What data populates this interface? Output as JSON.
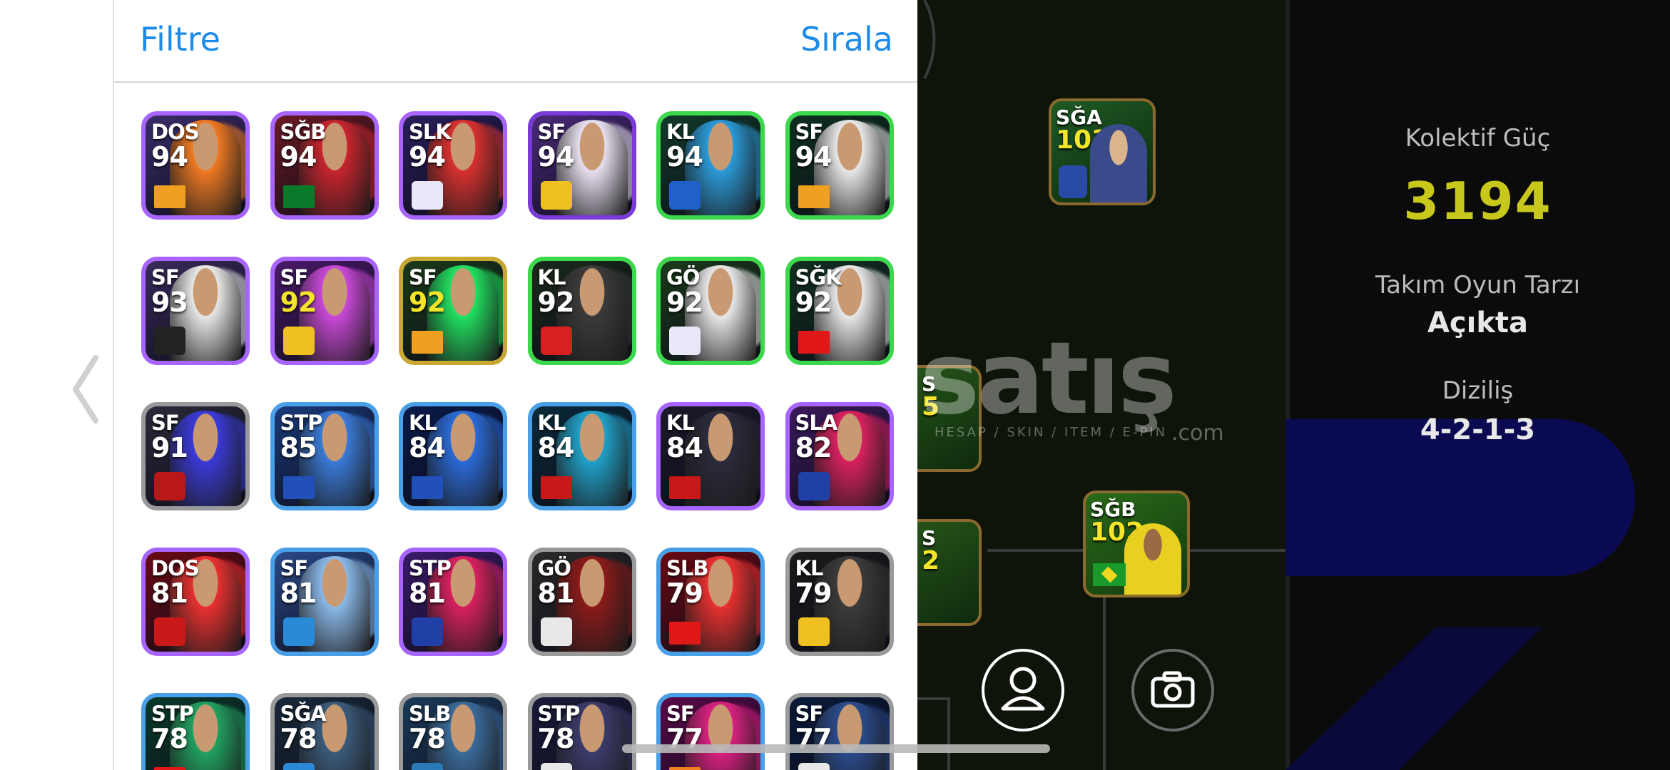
{
  "header": {
    "filter_label": "Filtre",
    "sort_label": "Sırala"
  },
  "cards": [
    {
      "pos": "DOS",
      "ovr": "94",
      "frame": "#a864ff",
      "bg": "#3b2d6a",
      "glow": "#f07a24",
      "badge": "flag-galatasaray",
      "badge_color": "#f0a020"
    },
    {
      "pos": "SĞB",
      "ovr": "94",
      "frame": "#a864ff",
      "bg": "#6a1a24",
      "glow": "#c8242e",
      "badge": "flag-portugal",
      "badge_color": "#0a7a2a"
    },
    {
      "pos": "SLK",
      "ovr": "94",
      "frame": "#a864ff",
      "bg": "#2a1e5c",
      "glow": "#d83030",
      "badge": "club-badge",
      "badge_color": "#e8e8f8"
    },
    {
      "pos": "SF",
      "ovr": "94",
      "frame": "#7a3ad8",
      "bg": "#4a2a7a",
      "glow": "#e8e0f0",
      "badge": "club-badge",
      "badge_color": "#f0c020"
    },
    {
      "pos": "KL",
      "ovr": "94",
      "frame": "#3ad84a",
      "bg": "#123a2a",
      "glow": "#2a9ad8",
      "badge": "club-badge",
      "badge_color": "#2060c8"
    },
    {
      "pos": "SF",
      "ovr": "94",
      "frame": "#3ad84a",
      "bg": "#0e3020",
      "glow": "#e8e8e8",
      "badge": "flag-galatasaray",
      "badge_color": "#f0a020"
    },
    {
      "pos": "SF",
      "ovr": "93",
      "frame": "#a864ff",
      "bg": "#3a2a5a",
      "glow": "#e8e8e8",
      "badge": "club-badge",
      "badge_color": "#222222"
    },
    {
      "pos": "SF",
      "ovr": "92",
      "frame": "#a864ff",
      "bg": "#4a1a6a",
      "glow": "#c848d8",
      "badge": "club-badge",
      "badge_color": "#f0c020",
      "gold": true
    },
    {
      "pos": "SF",
      "ovr": "92",
      "frame": "#c8a830",
      "bg": "#1a3a1a",
      "glow": "#20e060",
      "badge": "flag-galatasaray",
      "badge_color": "#f0a020",
      "gold": true
    },
    {
      "pos": "KL",
      "ovr": "92",
      "frame": "#3ad84a",
      "bg": "#1a2a1a",
      "glow": "#3a3a3a",
      "badge": "club-badge",
      "badge_color": "#d82020"
    },
    {
      "pos": "GÖ",
      "ovr": "92",
      "frame": "#3ad84a",
      "bg": "#1a3a1a",
      "glow": "#e8e8e8",
      "badge": "club-badge",
      "badge_color": "#e8e8f8"
    },
    {
      "pos": "SĞK",
      "ovr": "92",
      "frame": "#3ad84a",
      "bg": "#123020",
      "glow": "#e8e8e8",
      "badge": "flag-turkey",
      "badge_color": "#e01818"
    },
    {
      "pos": "SF",
      "ovr": "91",
      "frame": "#9a9a9a",
      "bg": "#2a2a3a",
      "glow": "#3a3ad8",
      "badge": "club-badge",
      "badge_color": "#b81818"
    },
    {
      "pos": "STP",
      "ovr": "85",
      "frame": "#4aa0e8",
      "bg": "#1a3a7a",
      "glow": "#3a7ad8",
      "badge": "flag-france",
      "badge_color": "#2050b8"
    },
    {
      "pos": "KL",
      "ovr": "84",
      "frame": "#4aa0e8",
      "bg": "#0a1a4a",
      "glow": "#2a6ad8",
      "badge": "flag-france",
      "badge_color": "#2050b8"
    },
    {
      "pos": "KL",
      "ovr": "84",
      "frame": "#4aa0e8",
      "bg": "#0a2a3a",
      "glow": "#20a0c8",
      "badge": "flag-morocco",
      "badge_color": "#c81818"
    },
    {
      "pos": "KL",
      "ovr": "84",
      "frame": "#a864ff",
      "bg": "#1a1a2a",
      "glow": "#2a2a3a",
      "badge": "flag-morocco",
      "badge_color": "#c81818"
    },
    {
      "pos": "SLA",
      "ovr": "82",
      "frame": "#a864ff",
      "bg": "#3a1a5a",
      "glow": "#d82060",
      "badge": "club-badge",
      "badge_color": "#2040a8"
    },
    {
      "pos": "DOS",
      "ovr": "81",
      "frame": "#a864ff",
      "bg": "#6a0a14",
      "glow": "#e83030",
      "badge": "club-badge",
      "badge_color": "#c81818"
    },
    {
      "pos": "SF",
      "ovr": "81",
      "frame": "#4aa0e8",
      "bg": "#2a4a8a",
      "glow": "#8ab8e8",
      "badge": "club-badge",
      "badge_color": "#2a8ad8"
    },
    {
      "pos": "STP",
      "ovr": "81",
      "frame": "#a864ff",
      "bg": "#3a1a6a",
      "glow": "#d82060",
      "badge": "club-badge",
      "badge_color": "#2040a8"
    },
    {
      "pos": "GÖ",
      "ovr": "81",
      "frame": "#9a9a9a",
      "bg": "#2a2a2a",
      "glow": "#8a1a1a",
      "badge": "club-badge",
      "badge_color": "#e8e8e8"
    },
    {
      "pos": "SLB",
      "ovr": "79",
      "frame": "#4aa0e8",
      "bg": "#6a0a14",
      "glow": "#e83030",
      "badge": "flag-austria",
      "badge_color": "#e01818"
    },
    {
      "pos": "KL",
      "ovr": "79",
      "frame": "#9a9a9a",
      "bg": "#1a1a1a",
      "glow": "#3a3a3a",
      "badge": "club-badge",
      "badge_color": "#f0c020"
    },
    {
      "pos": "STP",
      "ovr": "78",
      "frame": "#4aa0e8",
      "bg": "#0a3a2a",
      "glow": "#20a060",
      "badge": "flag",
      "badge_color": "#e01818"
    },
    {
      "pos": "SĞA",
      "ovr": "78",
      "frame": "#9a9a9a",
      "bg": "#1a2a3a",
      "glow": "#3a5a7a",
      "badge": "club-badge",
      "badge_color": "#2a8ad8"
    },
    {
      "pos": "SLB",
      "ovr": "78",
      "frame": "#9a9a9a",
      "bg": "#1a3a5a",
      "glow": "#3a6a9a",
      "badge": "club-badge",
      "badge_color": "#2a7ab8"
    },
    {
      "pos": "STP",
      "ovr": "78",
      "frame": "#9a9a9a",
      "bg": "#1a1a3a",
      "glow": "#3a3a6a",
      "badge": "club-badge",
      "badge_color": "#e8e8e8"
    },
    {
      "pos": "SF",
      "ovr": "77",
      "frame": "#4aa0e8",
      "bg": "#5a0a4a",
      "glow": "#d82080",
      "badge": "flag",
      "badge_color": "#f08020"
    },
    {
      "pos": "SF",
      "ovr": "77",
      "frame": "#9a9a9a",
      "bg": "#0a1a3a",
      "glow": "#2a4a8a",
      "badge": "club-badge",
      "badge_color": "#e8e8e8"
    }
  ],
  "field": {
    "watermark": "satış",
    "watermark_sub": "HESAP / SKIN / ITEM / E-PIN",
    "watermark_com": ".com",
    "players": [
      {
        "pos": "SĞA",
        "ovr": "103",
        "badge": "club-badge"
      },
      {
        "pos": "SĞB",
        "ovr": "102",
        "badge": "flag-brazil"
      },
      {
        "pos": "S",
        "ovr": "5",
        "badge": "club-badge"
      },
      {
        "pos": "S",
        "ovr": "2",
        "badge": "club-badge"
      }
    ]
  },
  "stats": {
    "power_label": "Kolektif Güç",
    "power_value": "3194",
    "style_label": "Takım Oyun Tarzı",
    "style_value": "Açıkta",
    "formation_label": "Diziliş",
    "formation_value": "4-2-1-3"
  }
}
